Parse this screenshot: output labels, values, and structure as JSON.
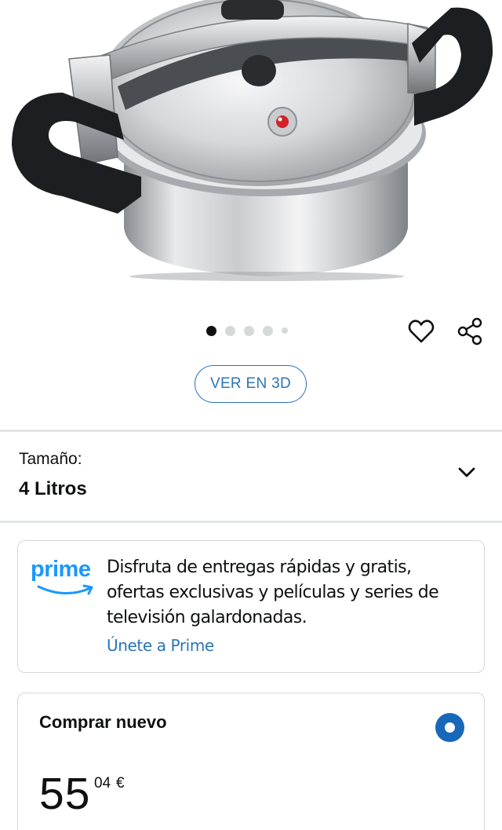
{
  "product": {
    "image_alt": "pressure-cooker-photo",
    "carousel": {
      "count": 5,
      "active_index": 0
    }
  },
  "actions": {
    "wishlist_icon": "heart-icon",
    "share_icon": "share-icon"
  },
  "view3d": {
    "label": "VER EN 3D"
  },
  "size": {
    "label": "Tamaño:",
    "value": "4 Litros",
    "icon": "chevron-down-icon"
  },
  "prime": {
    "logo_text": "prime",
    "description": "Disfruta de entregas rápidas y gratis, ofertas exclusivas y películas y series de televisión galardonadas.",
    "link": "Únete a Prime"
  },
  "buy_new": {
    "title": "Comprar nuevo",
    "price_whole": "55",
    "price_fraction": "04",
    "currency": "€",
    "selected": true
  },
  "colors": {
    "link_blue": "#2b74b9",
    "prime_blue": "#1a98ff",
    "radio_blue": "#1768b8",
    "divider": "#e3e6e6",
    "border": "#d5d9d9",
    "text": "#0f1111"
  }
}
